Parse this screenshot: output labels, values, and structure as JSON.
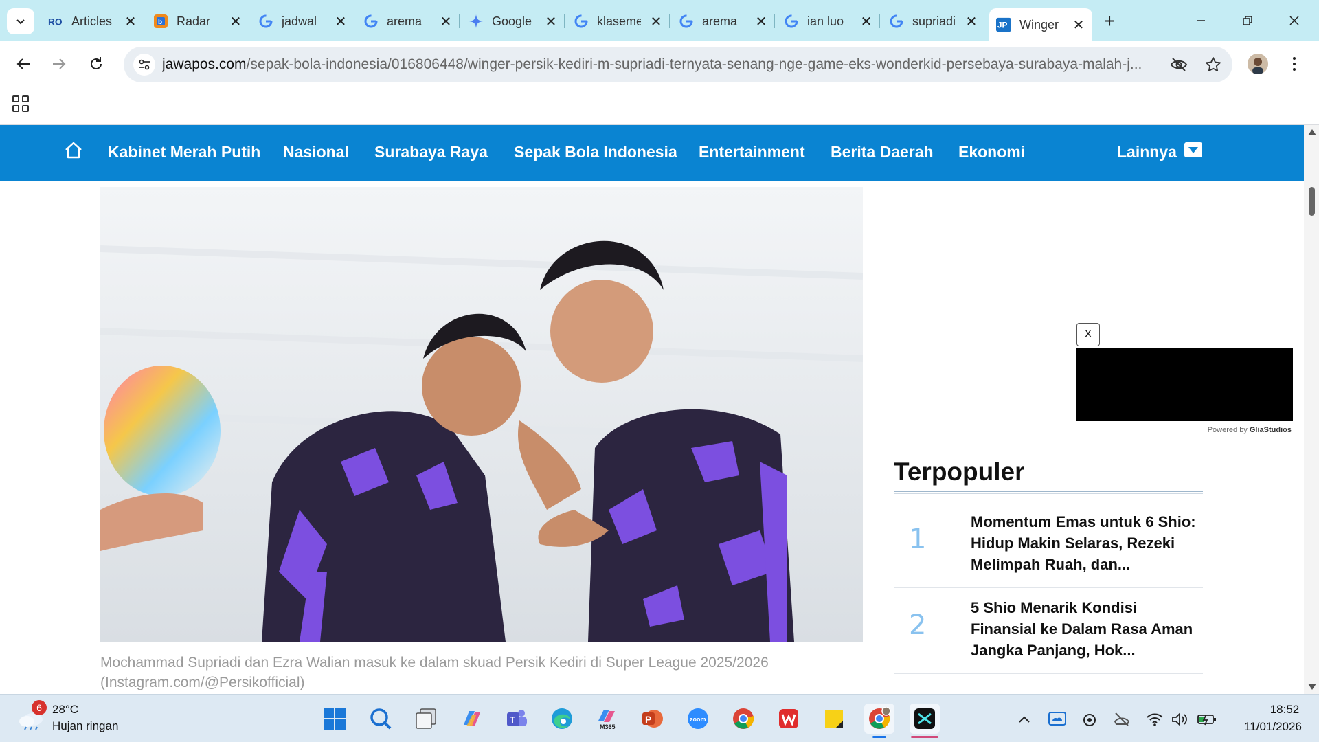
{
  "browser": {
    "tabs": [
      {
        "label": "Articles",
        "icon": "ro-favicon"
      },
      {
        "label": "Radar",
        "icon": "radar-favicon"
      },
      {
        "label": "jadwal",
        "icon": "google-favicon"
      },
      {
        "label": "arema",
        "icon": "google-favicon"
      },
      {
        "label": "Google",
        "icon": "gemini-favicon"
      },
      {
        "label": "klasemen",
        "icon": "google-favicon"
      },
      {
        "label": "arema",
        "icon": "google-favicon"
      },
      {
        "label": "ian luo",
        "icon": "google-favicon"
      },
      {
        "label": "supriadi",
        "icon": "google-favicon"
      },
      {
        "label": "Winger",
        "icon": "jawapos-favicon",
        "active": true
      }
    ],
    "close_glyph": "✕",
    "new_tab_glyph": "+",
    "url_domain": "jawapos.com",
    "url_path": "/sepak-bola-indonesia/016806448/winger-persik-kediri-m-supriadi-ternyata-senang-nge-game-eks-wonderkid-persebaya-surabaya-malah-j..."
  },
  "site": {
    "brand_color": "#0a84d2",
    "nav": [
      "Kabinet Merah Putih",
      "Nasional",
      "Surabaya Raya",
      "Sepak Bola Indonesia",
      "Entertainment",
      "Berita Daerah",
      "Ekonomi"
    ],
    "more_label": "Lainnya"
  },
  "article": {
    "caption": "Mochammad Supriadi dan Ezra Walian masuk ke dalam skuad Persik Kediri di Super League 2025/2026 (Instagram.com/@Persikofficial)"
  },
  "ad": {
    "close_label": "X",
    "powered_prefix": "Powered by",
    "powered_brand": "GliaStudios"
  },
  "popular": {
    "title": "Terpopuler",
    "items": [
      {
        "rank": "1",
        "title": "Momentum Emas untuk 6 Shio: Hidup Makin Selaras, Rezeki Melimpah Ruah, dan..."
      },
      {
        "rank": "2",
        "title": "5 Shio Menarik Kondisi Finansial ke Dalam Rasa Aman Jangka Panjang, Hok..."
      }
    ]
  },
  "taskbar": {
    "weather_temp": "28°C",
    "weather_desc": "Hujan ringan",
    "weather_badge": "6",
    "time": "18:52",
    "date": "11/01/2026",
    "apps": [
      "windows-start",
      "search",
      "task-view",
      "copilot",
      "teams",
      "edge",
      "m365",
      "powerpoint",
      "zoom",
      "chrome",
      "wps",
      "sticky-notes",
      "chrome-profile",
      "capcut"
    ]
  }
}
